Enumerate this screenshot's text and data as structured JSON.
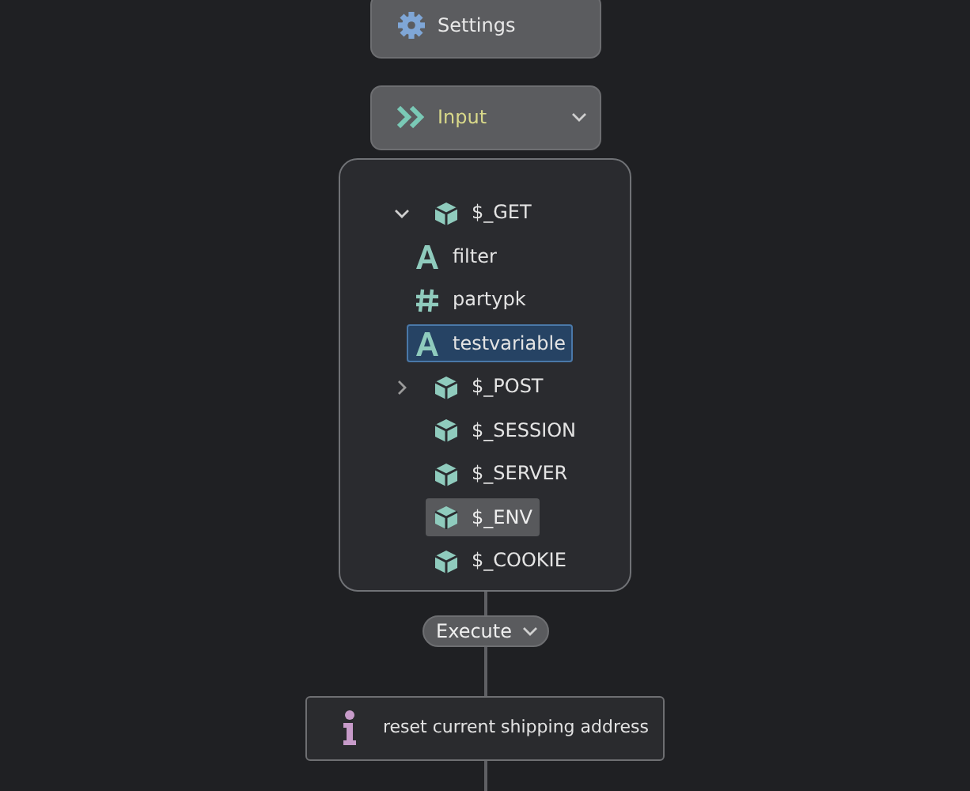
{
  "settings_node": {
    "label": "Settings"
  },
  "input_node": {
    "label": "Input"
  },
  "tree": [
    {
      "label": "$_GET",
      "kind": "object",
      "expanded": true,
      "selected": false,
      "highlighted": false,
      "children": [
        {
          "label": "filter",
          "kind": "string",
          "selected": false,
          "highlighted": false
        },
        {
          "label": "partypk",
          "kind": "number",
          "selected": false,
          "highlighted": false
        },
        {
          "label": "testvariable",
          "kind": "string",
          "selected": true,
          "highlighted": false
        }
      ]
    },
    {
      "label": "$_POST",
      "kind": "object",
      "expanded": false,
      "selected": false,
      "highlighted": false
    },
    {
      "label": "$_SESSION",
      "kind": "object",
      "selected": false,
      "highlighted": false
    },
    {
      "label": "$_SERVER",
      "kind": "object",
      "selected": false,
      "highlighted": false
    },
    {
      "label": "$_ENV",
      "kind": "object",
      "selected": false,
      "highlighted": true
    },
    {
      "label": "$_COOKIE",
      "kind": "object",
      "selected": false,
      "highlighted": false
    }
  ],
  "execute": {
    "label": "Execute"
  },
  "action_node": {
    "label": "reset current shipping address"
  }
}
